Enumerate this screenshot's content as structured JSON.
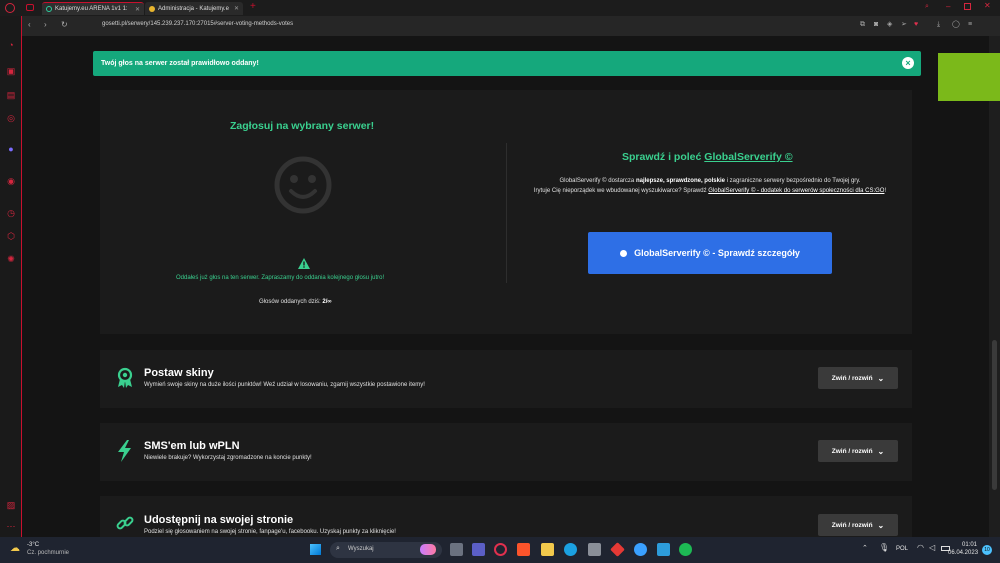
{
  "browser": {
    "tabs": [
      {
        "title": "Katujemy.eu ARENA 1v1 1:"
      },
      {
        "title": "Administracja - Katujemy.e"
      }
    ],
    "url": "gosetti.pl/serwery/145.239.237.170:27015#server-voting-methods-votes",
    "new_tab": "+"
  },
  "alert": {
    "text": "Twój głos na serwer został prawidłowo oddany!",
    "close": "×"
  },
  "vote": {
    "title": "Zagłosuj na wybrany serwer!",
    "warning": "Oddałeś już głos na ten serwer. Zapraszamy do oddania kolejnego głosu jutro!",
    "votes_label": "Głosów oddanych dziś:",
    "votes_value": "2/∞"
  },
  "gs": {
    "title_prefix": "Sprawdź i poleć",
    "title_link": "GlobalServerify ©",
    "text_1": "GlobalServerify © dostarcza",
    "text_bold": "najlepsze, sprawdzone, polskie",
    "text_2": "i zagraniczne serwery bezpośrednio do Twojej gry.",
    "text_3": "Irytuje Cię nieporządek we wbudowanej wyszukiwarce? Sprawdź",
    "text_link": "GlobalServerify © - dodatek do serwerów społeczności dla CS:GO",
    "text_end": "!",
    "button": "GlobalServerify © - Sprawdź szczegóły"
  },
  "sections": [
    {
      "title": "Postaw skiny",
      "desc": "Wymień swoje skiny na duże ilości punktów! Weź udział w losowaniu, zgarnij wszystkie postawione itemy!",
      "toggle": "Zwiń / rozwiń",
      "icon": "award-icon"
    },
    {
      "title": "SMS'em lub wPLN",
      "desc": "Niewiele brakuje? Wykorzystaj zgromadzone na koncie punkty!",
      "toggle": "Zwiń / rozwiń",
      "icon": "lightning-icon"
    },
    {
      "title": "Udostępnij na swojej stronie",
      "desc": "Podziel się głosowaniem na swojej stronie, fanpage'u, facebooku. Uzyskaj punkty za kliknięcie!",
      "toggle": "Zwiń / rozwiń",
      "icon": "link-icon"
    }
  ],
  "taskbar": {
    "weather_temp": "-3°C",
    "weather_desc": "Cz. pochmurnie",
    "search": "Wyszukaj",
    "lang": "POL",
    "time": "01:01",
    "date": "06.04.2023",
    "notif_count": "10"
  },
  "colors": {
    "accent_green": "#3ad08f",
    "alert_green": "#15a87c",
    "button_blue": "#2e6fe6",
    "opera_red": "#c8102e"
  }
}
